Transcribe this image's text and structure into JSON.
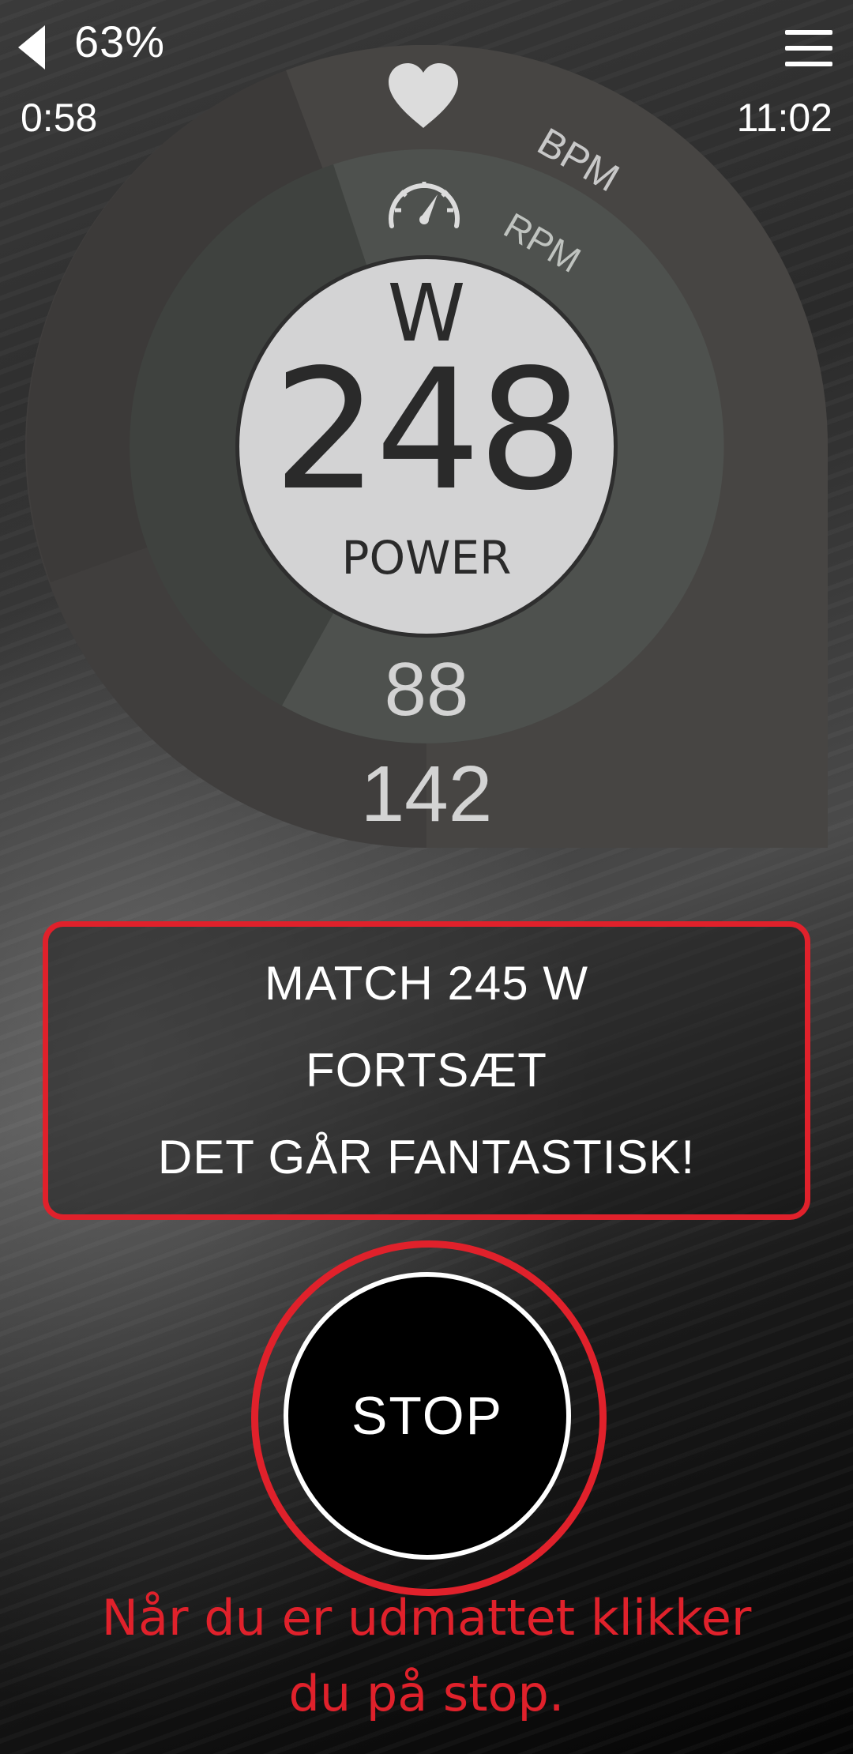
{
  "status": {
    "battery": "63%",
    "elapsed": "0:58",
    "clock": "11:02"
  },
  "gauge": {
    "unit": "W",
    "power_value": "248",
    "power_label": "POWER",
    "rpm_label": "RPM",
    "rpm_value": "88",
    "bpm_label": "BPM",
    "bpm_value": "142",
    "icons": [
      "heart-icon",
      "speedometer-icon"
    ]
  },
  "message": {
    "lines": [
      "MATCH 245 W",
      "FORTSÆT",
      "DET GÅR FANTASTISK!"
    ]
  },
  "stop_button": {
    "label": "STOP"
  },
  "hint": {
    "line1": "Når du er udmattet klikker",
    "line2": "du på stop."
  },
  "colors": {
    "accent_red": "#e0212b",
    "outer_ring": "#434141",
    "middle_ring": "#4f524f",
    "inner_circle": "#d3d3d4"
  }
}
